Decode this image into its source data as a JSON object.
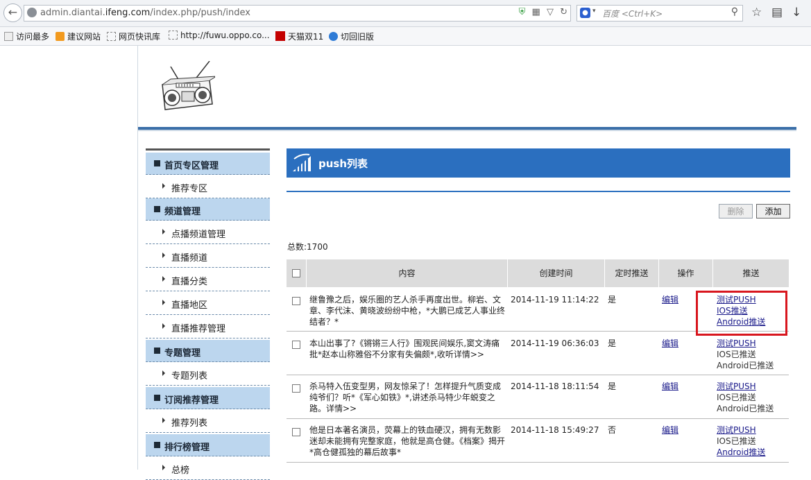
{
  "browser": {
    "url_prefix": "admin.diantai.",
    "url_domain": "ifeng.com",
    "url_path": "/index.php/push/index",
    "search_placeholder": "百度 <Ctrl+K>",
    "bookmarks": [
      {
        "label": "访问最多"
      },
      {
        "label": "建议网站"
      },
      {
        "label": "网页快讯库"
      },
      {
        "label": "http://fuwu.oppo.co..."
      },
      {
        "label": "天猫双11"
      },
      {
        "label": "切回旧版"
      }
    ]
  },
  "sidebar": {
    "sections": [
      {
        "label": "首页专区管理",
        "items": [
          "推荐专区"
        ]
      },
      {
        "label": "频道管理",
        "items": [
          "点播频道管理",
          "直播频道",
          "直播分类",
          "直播地区",
          "直播推荐管理"
        ]
      },
      {
        "label": "专题管理",
        "items": [
          "专题列表"
        ]
      },
      {
        "label": "订阅推荐管理",
        "items": [
          "推荐列表"
        ]
      },
      {
        "label": "排行榜管理",
        "items": [
          "总榜"
        ]
      }
    ]
  },
  "main": {
    "title": "push列表",
    "delete_label": "删除",
    "add_label": "添加",
    "total": "总数:1700",
    "columns": [
      "内容",
      "创建时间",
      "定时推送",
      "操作",
      "推送"
    ],
    "rows": [
      {
        "content": "继鲁豫之后，娱乐圈的艺人杀手再度出世。柳岩、文章、李代沫、黄晓波纷纷中枪，*大鹏已成艺人事业终结者？*",
        "created": "2014-11-19 11:14:22",
        "scheduled": "是",
        "edit": "编辑",
        "push_test": "测试PUSH",
        "ios": "IOS推送",
        "android": "Android推送"
      },
      {
        "content": "本山出事了?《锵锵三人行》围观民间娱乐,窦文涛痛批*赵本山称雅俗不分家有失偏颇*,收听详情>>",
        "created": "2014-11-19 06:36:03",
        "scheduled": "是",
        "edit": "编辑",
        "push_test": "测试PUSH",
        "ios": "IOS已推送",
        "android": "Android已推送"
      },
      {
        "content": "杀马特入伍变型男，网友惊呆了！怎样提升气质变成纯爷们？听*《军心如铁》*,讲述杀马特少年蜕变之路。详情>>",
        "created": "2014-11-18 18:11:54",
        "scheduled": "是",
        "edit": "编辑",
        "push_test": "测试PUSH",
        "ios": "IOS已推送",
        "android": "Android已推送"
      },
      {
        "content": "他是日本著名演员，荧幕上的铁血硬汉，拥有无数影迷却未能拥有完整家庭，他就是高仓健。《档案》揭开*高仓健孤独的幕后故事*",
        "created": "2014-11-18 15:49:27",
        "scheduled": "否",
        "edit": "编辑",
        "push_test": "测试PUSH",
        "ios": "IOS已推送",
        "android": "Android推送"
      }
    ]
  },
  "colors": {
    "title_bar": "#2b6fbf",
    "sidebar_section": "#bcd6ee",
    "highlight_box": "#d8161e"
  }
}
